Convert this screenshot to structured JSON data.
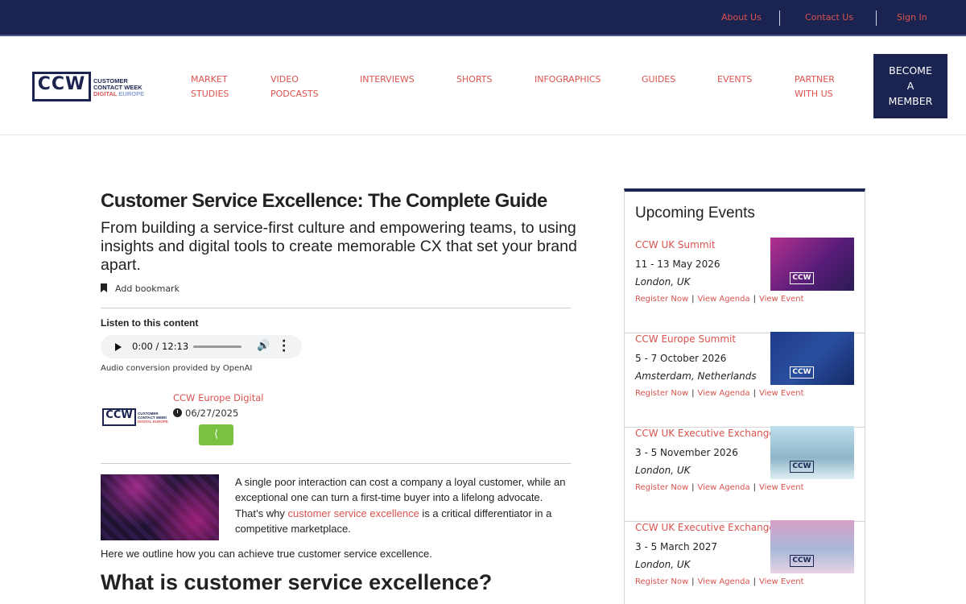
{
  "topbar": {
    "about": "About Us",
    "contact": "Contact Us",
    "signin": "Sign In"
  },
  "logo": {
    "short": "CCW",
    "line1": "CUSTOMER",
    "line2": "CONTACT WEEK",
    "line3a": "DIGITAL",
    "line3b": "EUROPE"
  },
  "nav": {
    "items": [
      {
        "l1": "MARKET",
        "l2": "STUDIES"
      },
      {
        "l1": "VIDEO",
        "l2": "PODCASTS"
      },
      {
        "l1": "INTERVIEWS",
        "l2": ""
      },
      {
        "l1": "SHORTS",
        "l2": ""
      },
      {
        "l1": "INFOGRAPHICS",
        "l2": ""
      },
      {
        "l1": "GUIDES",
        "l2": ""
      },
      {
        "l1": "EVENTS",
        "l2": ""
      },
      {
        "l1": "PARTNER",
        "l2": "WITH US"
      }
    ],
    "member": {
      "l1": "BECOME",
      "l2": "A",
      "l3": "MEMBER"
    }
  },
  "article": {
    "title": "Customer Service Excellence: The Complete Guide",
    "subtitle": "From building a service-first culture and empowering teams, to using insights and digital tools to create memorable CX that set your brand apart.",
    "bookmark": "Add bookmark",
    "listen_label": "Listen to this content",
    "audio_time": "0:00 / 12:13",
    "audio_credit": "Audio conversion provided by OpenAI",
    "author": {
      "logo_short": "CCW",
      "logo_l1": "CUSTOMER",
      "logo_l2": "CONTACT WEEK",
      "logo_l3": "DIGITAL EUROPE",
      "name": "CCW Europe Digital",
      "date": "06/27/2025"
    },
    "intro_pre": "A single poor interaction can cost a company a loyal customer, while an exceptional one can turn a first-time buyer into a lifelong advocate. That’s why ",
    "intro_link": "customer service excellence",
    "intro_post": " is a critical differentiator in a competitive marketplace.",
    "outline": "Here we outline how you can achieve true customer service excellence.",
    "h2": "What is customer service excellence?"
  },
  "sidebar": {
    "title": "Upcoming Events",
    "link_register": "Register Now",
    "link_agenda": "View Agenda",
    "link_event": "View Event",
    "events": [
      {
        "name": "CCW UK Summit",
        "dates": "11 - 13 May 2026",
        "location": "London, UK",
        "tag": "CCW"
      },
      {
        "name": "CCW Europe Summit",
        "dates": "5 - 7 October 2026",
        "location": "Amsterdam, Netherlands",
        "tag": "CCW"
      },
      {
        "name": "CCW UK Executive Exchange",
        "dates": "3 - 5 November 2026",
        "location": "London, UK",
        "tag": "CCW"
      },
      {
        "name": "CCW UK Executive Exchange",
        "dates": "3 - 5 March 2027",
        "location": "London, UK",
        "tag": "CCW"
      }
    ]
  }
}
